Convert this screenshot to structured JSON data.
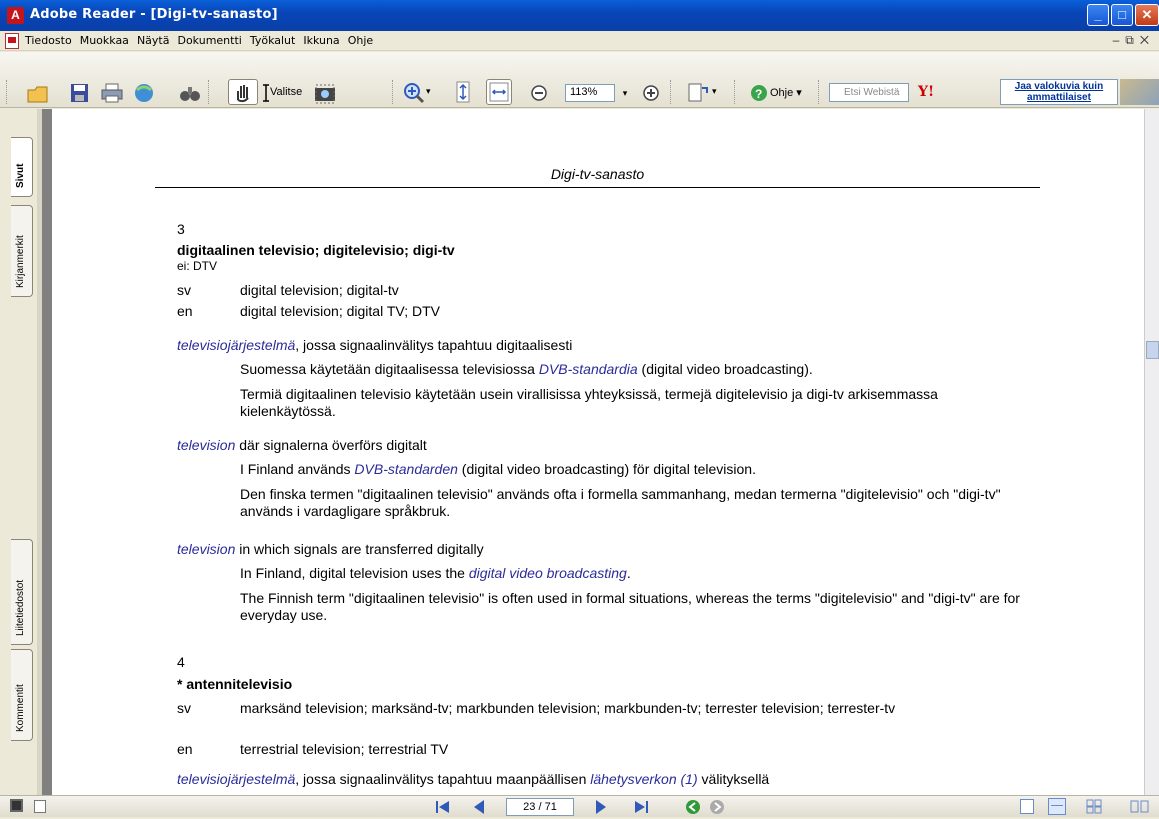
{
  "window": {
    "title": "Adobe Reader - [Digi-tv-sanasto]",
    "app_icon_glyph": "A",
    "accent_color": "#0a4fc4"
  },
  "menu": {
    "items": [
      "Tiedosto",
      "Muokkaa",
      "Näytä",
      "Dokumentti",
      "Työkalut",
      "Ikkuna",
      "Ohje"
    ]
  },
  "toolbar": {
    "select_label": "Valitse",
    "zoom_value": "113%",
    "help_label": "Ohje",
    "search_placeholder": "Etsi Webistä",
    "yahoo_label": "Y!",
    "promo_label": "Jaa valokuvia kuin ammattilaiset"
  },
  "sidebar": {
    "tabs": [
      "Sivut",
      "Kirjanmerkit",
      "Liitetiedostot",
      "Kommentit"
    ]
  },
  "document": {
    "header": "Digi-tv-sanasto",
    "entry3": {
      "number": "3",
      "term": "digitaalinen televisio; digitelevisio; digi-tv",
      "note": "ei: DTV",
      "sv_label": "sv",
      "sv_text": "digital television; digital-tv",
      "en_label": "en",
      "en_text": "digital television; digital TV; DTV",
      "fi_def_link": "televisiojärjestelmä",
      "fi_def_rest": ", jossa signaalinvälitys tapahtuu digitaalisesti",
      "fi_note1_a": "Suomessa käytetään digitaalisessa televisiossa ",
      "fi_note1_link": "DVB-standardia",
      "fi_note1_b": " (digital video broadcasting).",
      "fi_note2": "Termiä digitaalinen televisio käytetään usein virallisissa yhteyksissä, termejä digitelevisio ja digi-tv arkisemmassa kielenkäytössä.",
      "sv_def_link": "television",
      "sv_def_rest": " där signalerna överförs digitalt",
      "sv_note1_a": "I Finland används ",
      "sv_note1_link": "DVB-standarden",
      "sv_note1_b": " (digital video broadcasting) för digital television.",
      "sv_note2": "Den finska termen \"digitaalinen televisio\" används ofta i formella sammanhang, medan termerna \"digitelevisio\" och \"digi-tv\" används i vardagligare språkbruk.",
      "en_def_link": "television",
      "en_def_rest": " in which signals are transferred digitally",
      "en_note1_a": "In Finland, digital television uses the ",
      "en_note1_link": "digital video broadcasting",
      "en_note1_b": ".",
      "en_note2": "The Finnish term \"digitaalinen televisio\" is often used in formal situations, whereas the terms \"digitelevisio\" and \"digi-tv\" are for everyday use."
    },
    "entry4": {
      "number": "4",
      "term": "* antennitelevisio",
      "sv_label": "sv",
      "sv_text": "marksänd television; marksänd-tv; markbunden television; markbunden-tv; terrester television; terrester-tv",
      "en_label": "en",
      "en_text": "terrestrial television; terrestrial TV",
      "fi_def_link": "televisiojärjestelmä",
      "fi_def_mid": ", jossa signaalinvälitys tapahtuu maanpäällisen ",
      "fi_def_link2": "lähetysverkon (1)",
      "fi_def_end": " välityksellä"
    }
  },
  "statusbar": {
    "page_indicator": "23 / 71"
  }
}
